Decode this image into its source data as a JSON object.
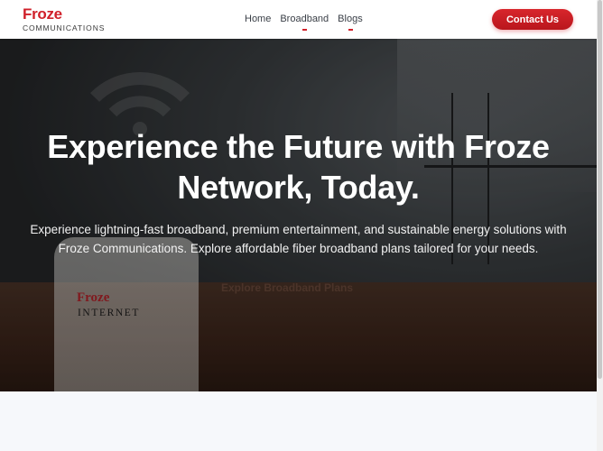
{
  "header": {
    "logo_main": "Froze",
    "logo_sub": "COMMUNICATIONS",
    "nav": [
      {
        "label": "Home"
      },
      {
        "label": "Broadband"
      },
      {
        "label": "Blogs"
      }
    ],
    "contact_label": "Contact Us"
  },
  "hero": {
    "title": "Experience the Future with Froze Network, Today.",
    "subtitle": "Experience lightning-fast broadband, premium entertainment, and sustainable energy solutions with Froze Communications. Explore affordable fiber broadband plans tailored for your needs.",
    "cta_label": "Explore Broadband Plans",
    "router_brand": "Froze",
    "router_sub": "INTERNET"
  },
  "colors": {
    "brand": "#d0202a",
    "nav_text": "#3a3f47",
    "page_bg": "#f6f8fb"
  },
  "icons": {
    "wifi": "wifi-icon"
  }
}
